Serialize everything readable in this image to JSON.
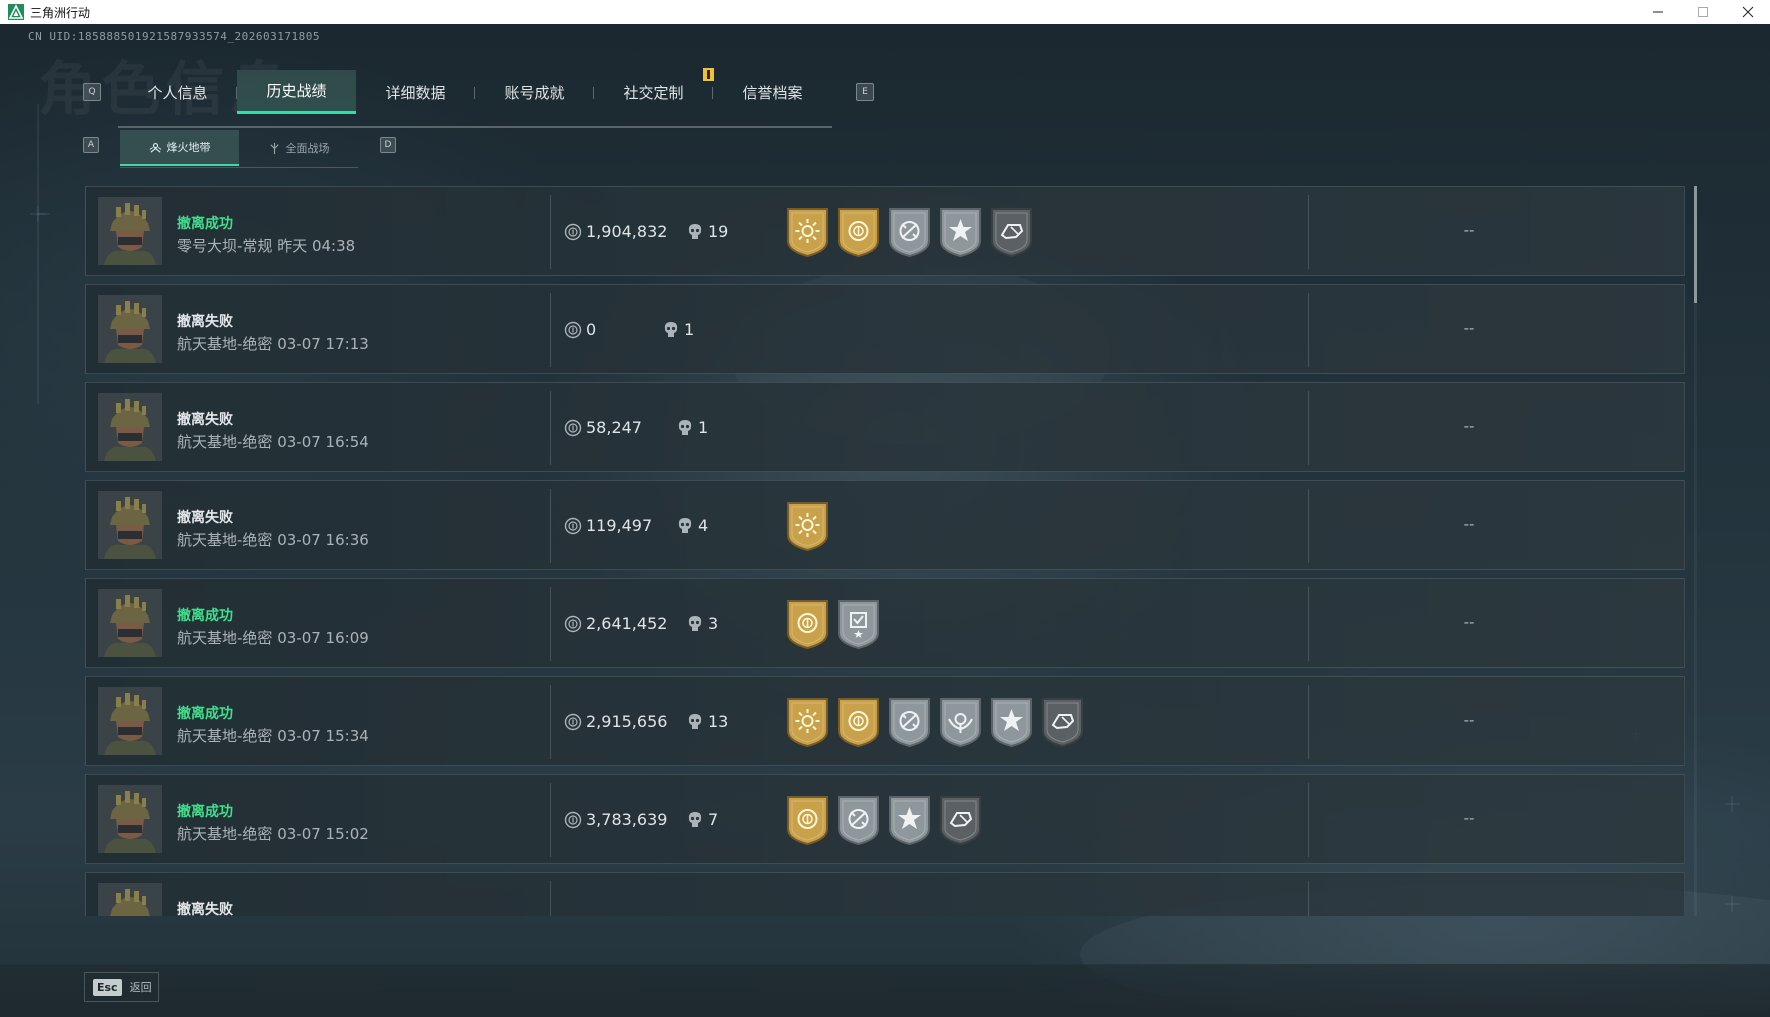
{
  "window": {
    "title": "三角洲行动",
    "controls": [
      "minimize",
      "maximize",
      "close"
    ]
  },
  "header": {
    "uid": "CN UID:185888501921587933574_202603171805",
    "background_text": "角色信息",
    "tab_prev_key": "Q",
    "tab_next_key": "E",
    "tabs": [
      {
        "label": "个人信息",
        "active": false
      },
      {
        "label": "历史战绩",
        "active": true
      },
      {
        "label": "详细数据",
        "active": false
      },
      {
        "label": "账号成就",
        "active": false
      },
      {
        "label": "社交定制",
        "active": false
      },
      {
        "label": "信誉档案",
        "active": false
      }
    ],
    "subtab_prev_key": "A",
    "subtab_next_key": "D",
    "subtabs": [
      {
        "label": "烽火地带",
        "icon": "extraction-mode-icon",
        "active": true
      },
      {
        "label": "全面战场",
        "icon": "warfare-mode-icon",
        "active": false
      }
    ]
  },
  "colors": {
    "accent": "#3fd7a6",
    "success": "#3fe08c",
    "badge_gold": "#c8a14a",
    "badge_silver": "#8e979b",
    "notify": "#f0c23a"
  },
  "records": [
    {
      "status": "撤离成功",
      "success": true,
      "map": "零号大坝-常规",
      "time": "昨天 04:38",
      "value": "1,904,832",
      "kills": "19",
      "badges": [
        "sun-gold",
        "coin-gold",
        "cross-silver",
        "star-silver",
        "hand-dark"
      ],
      "extra": "--"
    },
    {
      "status": "撤离失败",
      "success": false,
      "map": "航天基地-绝密",
      "time": "03-07 17:13",
      "value": "0",
      "kills": "1",
      "badges": [],
      "extra": "--"
    },
    {
      "status": "撤离失败",
      "success": false,
      "map": "航天基地-绝密",
      "time": "03-07 16:54",
      "value": "58,247",
      "kills": "1",
      "badges": [],
      "extra": "--"
    },
    {
      "status": "撤离失败",
      "success": false,
      "map": "航天基地-绝密",
      "time": "03-07 16:36",
      "value": "119,497",
      "kills": "4",
      "badges": [
        "sun-gold"
      ],
      "extra": "--"
    },
    {
      "status": "撤离成功",
      "success": true,
      "map": "航天基地-绝密",
      "time": "03-07 16:09",
      "value": "2,641,452",
      "kills": "3",
      "badges": [
        "coin-gold",
        "shield-silver"
      ],
      "extra": "--"
    },
    {
      "status": "撤离成功",
      "success": true,
      "map": "航天基地-绝密",
      "time": "03-07 15:34",
      "value": "2,915,656",
      "kills": "13",
      "badges": [
        "sun-gold",
        "coin-gold",
        "cross-silver",
        "wings-silver",
        "star-silver",
        "hand-dark"
      ],
      "extra": "--"
    },
    {
      "status": "撤离成功",
      "success": true,
      "map": "航天基地-绝密",
      "time": "03-07 15:02",
      "value": "3,783,639",
      "kills": "7",
      "badges": [
        "coin-gold",
        "cross-silver",
        "star-silver",
        "hand-dark"
      ],
      "extra": "--"
    },
    {
      "status": "撤离失败",
      "success": false,
      "map": "",
      "time": "",
      "value": "",
      "kills": "",
      "badges": [],
      "extra": ""
    }
  ],
  "footer": {
    "esc_key": "Esc",
    "esc_label": "返回"
  }
}
